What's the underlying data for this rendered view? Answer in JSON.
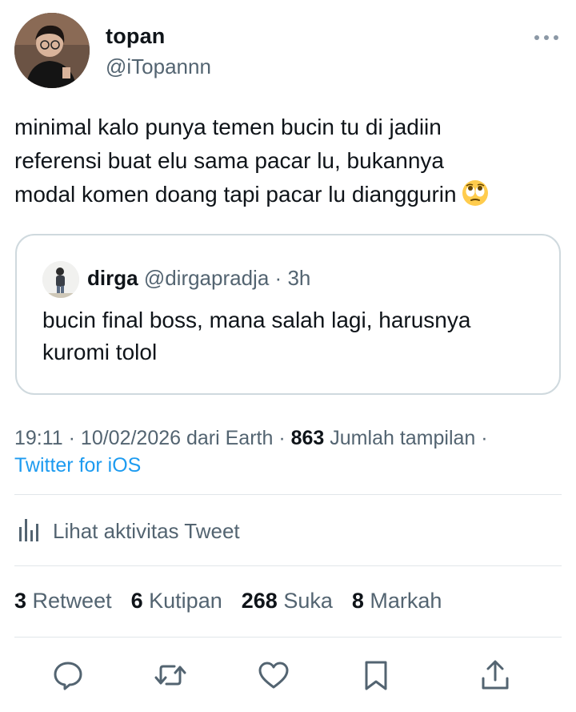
{
  "author": {
    "name": "topan",
    "handle": "@iTopannn"
  },
  "tweet": {
    "lines": [
      "minimal kalo punya temen bucin tu di jadiin",
      "referensi buat elu sama pacar lu, bukannya",
      "modal komen doang tapi pacar lu dianggurin"
    ],
    "emoji": "face-with-rolling-eyes"
  },
  "quote": {
    "name": "dirga",
    "handle": "@dirgapradja",
    "separator": "·",
    "time": "3h",
    "lines": [
      "bucin final boss, mana salah lagi, harusnya",
      "kuromi tolol"
    ]
  },
  "meta": {
    "timestamp": "19:11 · 10/02/2026 dari Earth ·",
    "views_count": "863",
    "views_label": "Jumlah tampilan ·",
    "source": "Twitter for iOS"
  },
  "activity": {
    "label": "Lihat aktivitas Tweet"
  },
  "stats": [
    {
      "count": "3",
      "label": "Retweet"
    },
    {
      "count": "6",
      "label": "Kutipan"
    },
    {
      "count": "268",
      "label": "Suka"
    },
    {
      "count": "8",
      "label": "Markah"
    }
  ],
  "icons": {
    "more": "more-horizontal-icon",
    "activity": "bar-chart-icon",
    "reply": "reply-icon",
    "retweet": "retweet-icon",
    "like": "heart-icon",
    "bookmark": "bookmark-icon",
    "share": "share-icon"
  },
  "colors": {
    "text": "#0f1419",
    "secondary": "#536471",
    "link": "#1d9bf0",
    "border": "#cfd9de"
  }
}
